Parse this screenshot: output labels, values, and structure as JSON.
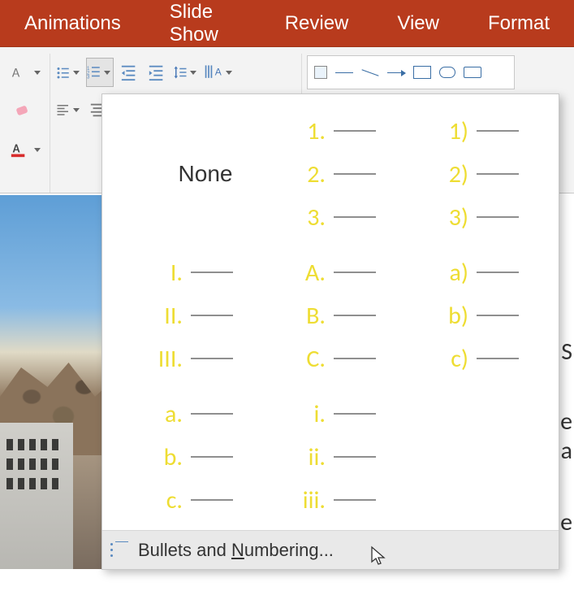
{
  "ribbon": {
    "tabs": [
      "Animations",
      "Slide Show",
      "Review",
      "View",
      "Format"
    ]
  },
  "numbering_dropdown": {
    "none_label": "None",
    "options": [
      [
        "1.",
        "2.",
        "3."
      ],
      [
        "1)",
        "2)",
        "3)"
      ],
      [
        "I.",
        "II.",
        "III."
      ],
      [
        "A.",
        "B.",
        "C."
      ],
      [
        "a)",
        "b)",
        "c)"
      ],
      [
        "a.",
        "b.",
        "c."
      ],
      [
        "i.",
        "ii.",
        "iii."
      ]
    ],
    "footer_prefix": "Bullets and ",
    "footer_underlined": "N",
    "footer_suffix": "umbering..."
  },
  "background_words": [
    "S",
    "le",
    "a",
    "e"
  ]
}
